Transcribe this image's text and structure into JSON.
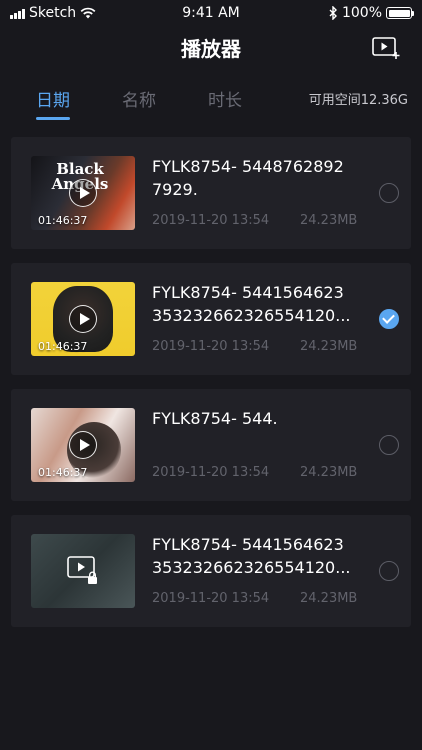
{
  "status_bar": {
    "carrier": "Sketch",
    "time": "9:41 AM",
    "battery": "100%"
  },
  "nav": {
    "title": "播放器",
    "action_icon": "add-video-icon"
  },
  "tabs": [
    {
      "label": "日期",
      "active": true
    },
    {
      "label": "名称",
      "active": false
    },
    {
      "label": "时长",
      "active": false
    }
  ],
  "storage": {
    "label": "可用空间12.36G"
  },
  "videos": [
    {
      "title_line1": "FYLK8754- 5448762892",
      "title_line2": "7929.",
      "duration": "01:46:37",
      "thumb_text": "Black Angels",
      "date": "2019-11-20 13:54",
      "size": "24.23MB",
      "selected": false
    },
    {
      "title_line1": "FYLK8754- 5441564623",
      "title_line2": "353232662326554120...",
      "duration": "01:46:37",
      "date": "2019-11-20 13:54",
      "size": "24.23MB",
      "selected": true
    },
    {
      "title_line1": "FYLK8754- 544.",
      "title_line2": "",
      "duration": "01:46:37",
      "date": "2019-11-20 13:54",
      "size": "24.23MB",
      "selected": false
    },
    {
      "title_line1": "FYLK8754- 5441564623",
      "title_line2": "353232662326554120...",
      "duration": "",
      "date": "2019-11-20 13:54",
      "size": "24.23MB",
      "selected": false,
      "locked": true
    }
  ],
  "colors": {
    "background": "#18181d",
    "card": "#212127",
    "accent": "#5aa6f0",
    "muted_text": "#62636c"
  }
}
